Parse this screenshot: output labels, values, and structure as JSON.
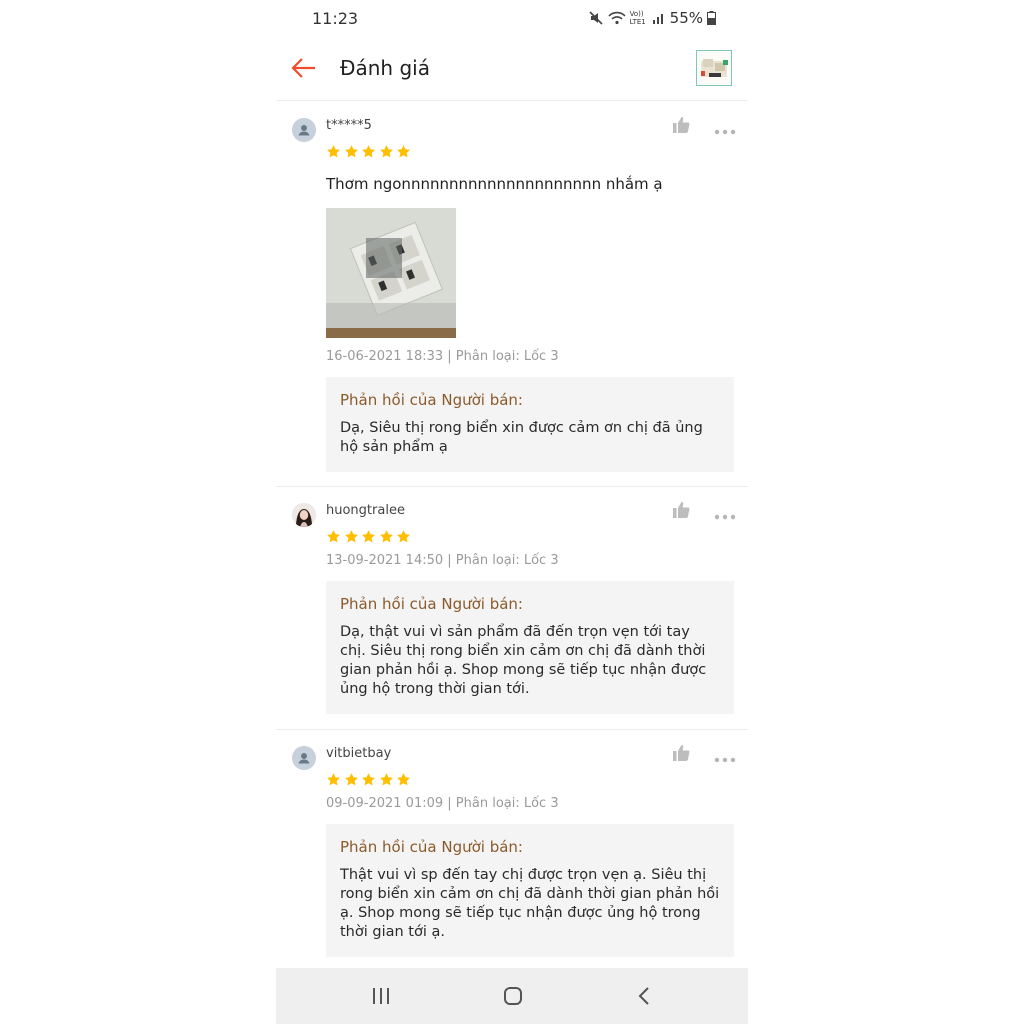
{
  "status_bar": {
    "time": "11:23",
    "battery": "55%",
    "volte_label": "Vo)) LTE1"
  },
  "header": {
    "title": "Đánh giá"
  },
  "reviews": [
    {
      "username": "t*****5",
      "rating": 5,
      "text": "Thơm ngonnnnnnnnnnnnnnnnnnnnn nhắm ạ",
      "meta": "16-06-2021 18:33 | Phân loại: Lốc 3",
      "reply_title": "Phản hồi của Người bán:",
      "reply_text": "Dạ, Siêu thị rong biển xin được cảm ơn chị đã ủng hộ sản phẩm ạ"
    },
    {
      "username": "huongtralee",
      "rating": 5,
      "meta": "13-09-2021 14:50 | Phân loại: Lốc 3",
      "reply_title": "Phản hồi của Người bán:",
      "reply_text": "Dạ, thật vui vì sản phẩm đã đến trọn vẹn tới tay chị. Siêu thị rong biển xin cảm ơn chị đã dành thời gian phản hồi ạ. Shop mong sẽ tiếp tục nhận được ủng hộ trong thời gian tới."
    },
    {
      "username": "vitbietbay",
      "rating": 5,
      "meta": "09-09-2021 01:09 | Phân loại: Lốc 3",
      "reply_title": "Phản hồi của Người bán:",
      "reply_text": "Thật vui vì sp đến tay chị được trọn vẹn ạ. Siêu thị rong biển xin cảm ơn chị đã dành thời gian phản hồi ạ. Shop mong sẽ tiếp tục nhận được ủng hộ trong thời gian tới ạ."
    }
  ],
  "colors": {
    "accent": "#ee4d2d",
    "star": "#ffbf00",
    "reply_title": "#8b5a2b"
  },
  "icons": {
    "back": "arrow-left-icon",
    "like": "thumbs-up-icon",
    "more": "more-horizontal-icon",
    "nav_recent": "recent-apps-icon",
    "nav_home": "home-icon",
    "nav_back": "chevron-left-icon"
  }
}
